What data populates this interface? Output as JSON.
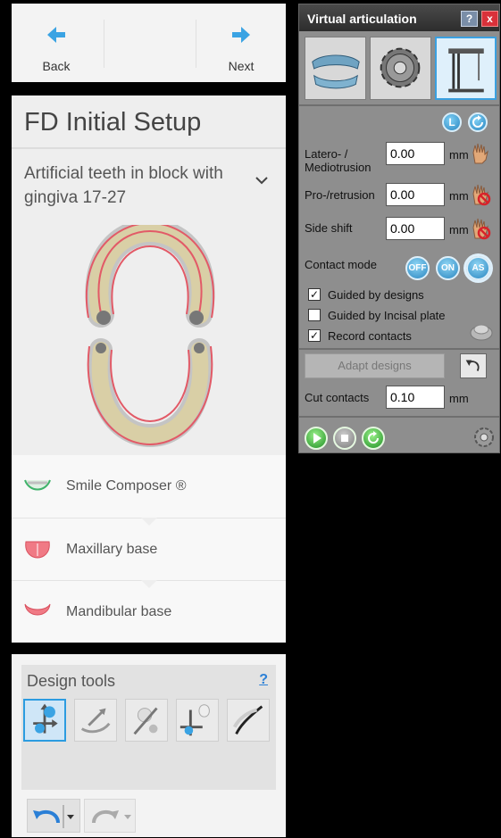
{
  "nav": {
    "back_label": "Back",
    "next_label": "Next"
  },
  "setup": {
    "title": "FD Initial Setup",
    "dropdown_text": "Artificial teeth in block with gingiva 17-27",
    "rows": [
      {
        "label": "Smile Composer ®"
      },
      {
        "label": "Maxillary base"
      },
      {
        "label": "Mandibular base"
      }
    ]
  },
  "design_tools": {
    "title": "Design tools",
    "help": "?"
  },
  "va": {
    "title": "Virtual articulation",
    "help": "?",
    "close": "x",
    "lr_left": "L",
    "latero_label_1": "Latero- /",
    "latero_label_2": "Mediotrusion",
    "latero_value": "0.00",
    "pro_label": "Pro-/retrusion",
    "pro_value": "0.00",
    "side_label": "Side shift",
    "side_value": "0.00",
    "unit": "mm",
    "contact_mode_label": "Contact mode",
    "mode_off": "OFF",
    "mode_on": "ON",
    "mode_as": "AS",
    "guided_designs": "Guided by designs",
    "guided_designs_checked": "✓",
    "guided_incisal": "Guided by Incisal plate",
    "record_contacts": "Record contacts",
    "record_contacts_checked": "✓",
    "adapt_designs": "Adapt designs",
    "cut_contacts_label": "Cut contacts",
    "cut_contacts_value": "0.10"
  }
}
